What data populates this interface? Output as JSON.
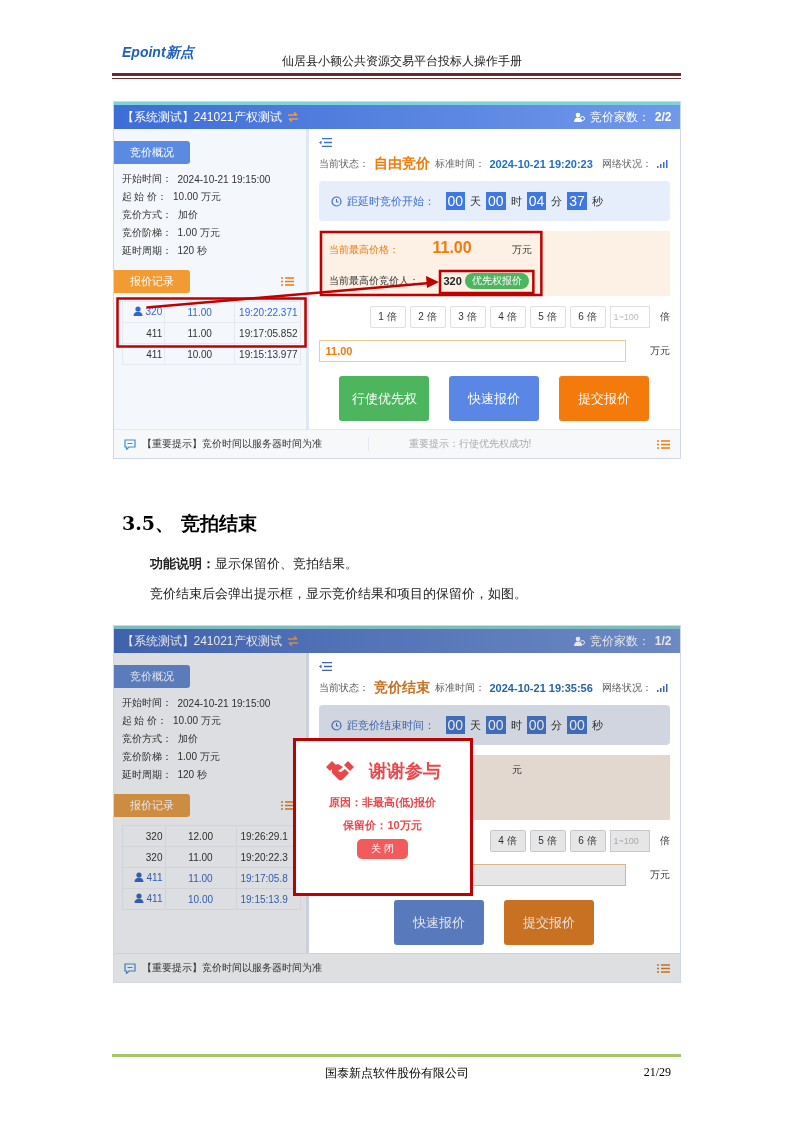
{
  "header": {
    "logo": "Epoint新点",
    "title": "仙居县小额公共资源交易平台投标人操作手册"
  },
  "blocks": [
    {
      "kind": "screen",
      "title": "【系统测试】241021产权测试",
      "count_label": "竞价家数：",
      "count": "2/2",
      "annotated": true,
      "overview_tab": "竞价概况",
      "info": [
        {
          "label": "开始时间：",
          "value": "2024-10-21 19:15:00"
        },
        {
          "label": "起 始 价：",
          "value": "10.00 万元"
        },
        {
          "label": "竞价方式：",
          "value": "加价"
        },
        {
          "label": "竞价阶梯：",
          "value": "1.00 万元"
        },
        {
          "label": "延时周期：",
          "value": "120 秒"
        }
      ],
      "records_tab": "报价记录",
      "records": [
        {
          "bidder": "320",
          "price": "11.00",
          "time": "19:20:22.371",
          "mine": true
        },
        {
          "bidder": "411",
          "price": "11.00",
          "time": "19:17:05.852",
          "mine": false
        },
        {
          "bidder": "411",
          "price": "10.00",
          "time": "19:15:13.977",
          "mine": false
        }
      ],
      "status_label": "当前状态：",
      "status": "自由竞价",
      "time_label": "标准时间：",
      "time": "2024-10-21 19:20:23",
      "network_label": "网络状况：",
      "countdown": {
        "label": "距延时竞价开始：",
        "parts": [
          {
            "value": "00",
            "unit": "天"
          },
          {
            "value": "00",
            "unit": "时"
          },
          {
            "value": "04",
            "unit": "分"
          },
          {
            "value": "37",
            "unit": "秒"
          }
        ]
      },
      "price_card": {
        "label": "当前最高价格：",
        "price": "11.00",
        "unit": "万元",
        "bidder_label": "当前最高价竞价人：",
        "bidder": "320",
        "badge": "优先权报价"
      },
      "multipliers": [
        "1 倍",
        "2 倍",
        "3 倍",
        "4 倍",
        "5 倍",
        "6 倍"
      ],
      "multiplier_placeholder": "1~100",
      "multiplier_unit": "倍",
      "price_input": {
        "value": "11.00",
        "unit": "万元"
      },
      "actions": [
        {
          "label": "行使优先权",
          "kind": "priority"
        },
        {
          "label": "快速报价",
          "kind": "quick"
        },
        {
          "label": "提交报价",
          "kind": "submit"
        }
      ],
      "notices": [
        "【重要提示】竞价时间以服务器时间为准",
        "重要提示：行使优先权成功!"
      ]
    },
    {
      "kind": "heading",
      "text": "3.5、 竞拍结束"
    },
    {
      "kind": "paragraph",
      "text": "**功能说明：**显示保留价、竞拍结果。"
    },
    {
      "kind": "paragraph",
      "text": "竞价结束后会弹出提示框，显示竞价结果和项目的保留价，如图。"
    },
    {
      "kind": "screen",
      "title": "【系统测试】241021产权测试",
      "count_label": "竞价家数：",
      "count": "1/2",
      "overview_tab": "竞价概况",
      "info": [
        {
          "label": "开始时间：",
          "value": "2024-10-21 19:15:00"
        },
        {
          "label": "起 始 价：",
          "value": "10.00 万元"
        },
        {
          "label": "竞价方式：",
          "value": "加价"
        },
        {
          "label": "竞价阶梯：",
          "value": "1.00 万元"
        },
        {
          "label": "延时周期：",
          "value": "120 秒"
        }
      ],
      "records_tab": "报价记录",
      "records": [
        {
          "bidder": "320",
          "price": "12.00",
          "time": "19:26:29.1",
          "mine": false
        },
        {
          "bidder": "320",
          "price": "11.00",
          "time": "19:20:22.3",
          "mine": false
        },
        {
          "bidder": "411",
          "price": "11.00",
          "time": "19:17:05.8",
          "mine": true
        },
        {
          "bidder": "411",
          "price": "10.00",
          "time": "19:15:13.9",
          "mine": true
        }
      ],
      "status_label": "当前状态：",
      "status": "竞价结束",
      "time_label": "标准时间：",
      "time": "2024-10-21 19:35:56",
      "network_label": "网络状况：",
      "countdown": {
        "label": "距竞价结束时间：",
        "parts": [
          {
            "value": "00",
            "unit": "天"
          },
          {
            "value": "00",
            "unit": "时"
          },
          {
            "value": "00",
            "unit": "分"
          },
          {
            "value": "00",
            "unit": "秒"
          }
        ]
      },
      "price_card": {
        "unit": "元"
      },
      "multipliers": [
        "4 倍",
        "5 倍",
        "6 倍"
      ],
      "multiplier_placeholder": "1~100",
      "multiplier_unit": "倍",
      "price_input": {
        "unit": "万元"
      },
      "actions": [
        {
          "label": "快速报价",
          "kind": "quick"
        },
        {
          "label": "提交报价",
          "kind": "submit"
        }
      ],
      "notices": [
        "【重要提示】竞价时间以服务器时间为准"
      ],
      "dialog": {
        "title": "谢谢参与",
        "reason": "原因：非最高(低)报价",
        "reserve": "保留价：10万元",
        "close": "关 闭"
      }
    }
  ],
  "footer": {
    "company": "国泰新点软件股份有限公司",
    "page": "21/29"
  }
}
